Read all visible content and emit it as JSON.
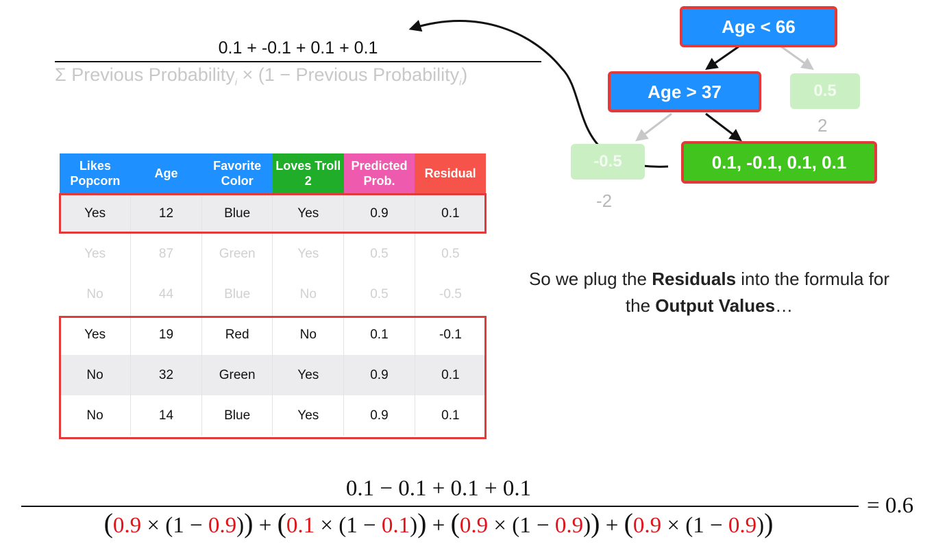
{
  "top_formula": {
    "numerator": "0.1 + -0.1 + 0.1 + 0.1",
    "denominator_partial": "Σ Previous Probability",
    "denominator_mid": " × (1 − Previous Probability",
    "denominator_end": ")",
    "subscript": "i"
  },
  "tree": {
    "root": "Age < 66",
    "left": "Age > 37",
    "right_leaf": "0.5",
    "right_leaf_label": "2",
    "left_left_leaf": "-0.5",
    "left_left_leaf_label": "-2",
    "left_right_leaf": "0.1, -0.1, 0.1, 0.1"
  },
  "table": {
    "headers": [
      {
        "label": "Likes Popcorn",
        "color": "#1e90ff"
      },
      {
        "label": "Age",
        "color": "#1e90ff"
      },
      {
        "label": "Favorite Color",
        "color": "#1e90ff"
      },
      {
        "label": "Loves Troll 2",
        "color": "#20ae2a"
      },
      {
        "label": "Predicted Prob.",
        "color": "#ee5aae"
      },
      {
        "label": "Residual",
        "color": "#f6544b"
      }
    ],
    "rows": [
      [
        "Yes",
        "12",
        "Blue",
        "Yes",
        "0.9",
        "0.1"
      ],
      [
        "Yes",
        "87",
        "Green",
        "Yes",
        "0.5",
        "0.5"
      ],
      [
        "No",
        "44",
        "Blue",
        "No",
        "0.5",
        "-0.5"
      ],
      [
        "Yes",
        "19",
        "Red",
        "No",
        "0.1",
        "-0.1"
      ],
      [
        "No",
        "32",
        "Green",
        "Yes",
        "0.9",
        "0.1"
      ],
      [
        "No",
        "14",
        "Blue",
        "Yes",
        "0.9",
        "0.1"
      ]
    ]
  },
  "note": {
    "part1": "So we plug the ",
    "bold1": "Residuals",
    "part2": " into the formula for the ",
    "bold2": "Output Values",
    "part3": "…"
  },
  "bottom_formula": {
    "numerator": "0.1 − 0.1 + 0.1 + 0.1",
    "terms": [
      {
        "p": "0.9",
        "q": "0.9"
      },
      {
        "p": "0.1",
        "q": "0.1"
      },
      {
        "p": "0.9",
        "q": "0.9"
      },
      {
        "p": "0.9",
        "q": "0.9"
      }
    ],
    "times": " × (1 − ",
    "plus": " + ",
    "result": "= 0.6"
  },
  "colors": {
    "accent_blue": "#1e90ff",
    "accent_green": "#42c41f",
    "highlight_red": "#e23a3a",
    "formula_red": "#e0141a"
  }
}
